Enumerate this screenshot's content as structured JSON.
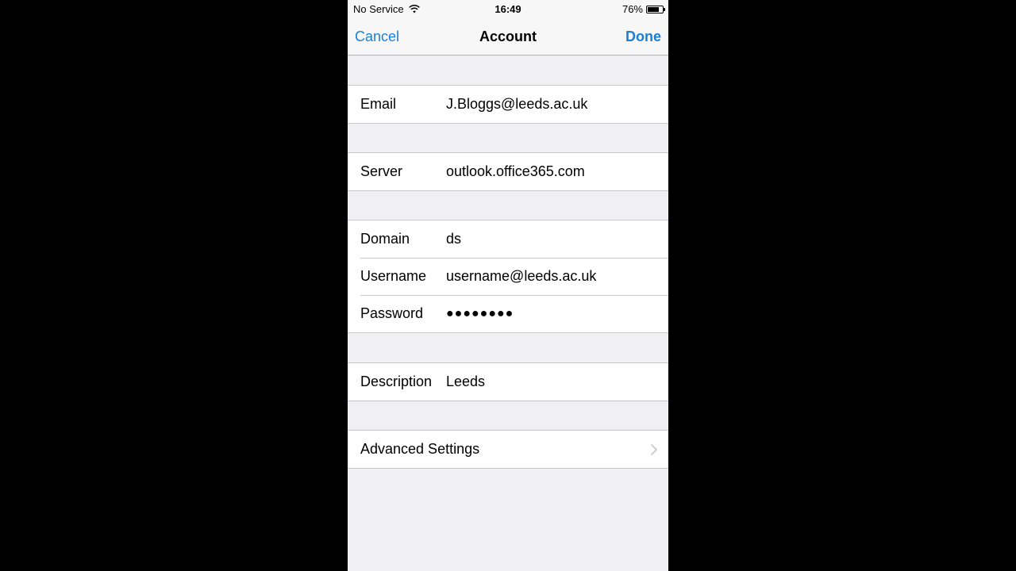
{
  "status_bar": {
    "carrier": "No Service",
    "time": "16:49",
    "battery": "76%",
    "battery_level": 0.76
  },
  "nav": {
    "cancel": "Cancel",
    "title": "Account",
    "done": "Done"
  },
  "fields": {
    "email": {
      "label": "Email",
      "value": "J.Bloggs@leeds.ac.uk"
    },
    "server": {
      "label": "Server",
      "value": "outlook.office365.com"
    },
    "domain": {
      "label": "Domain",
      "value": "ds"
    },
    "username": {
      "label": "Username",
      "value": "username@leeds.ac.uk"
    },
    "password": {
      "label": "Password",
      "value": "●●●●●●●●"
    },
    "description": {
      "label": "Description",
      "value": "Leeds"
    }
  },
  "advanced": {
    "label": "Advanced Settings"
  },
  "colors": {
    "accent": "#1a7fd6",
    "background": "#efeff4"
  },
  "icons": {
    "wifi": "wifi-icon",
    "battery": "battery-icon",
    "chevron": "chevron-right-icon"
  }
}
